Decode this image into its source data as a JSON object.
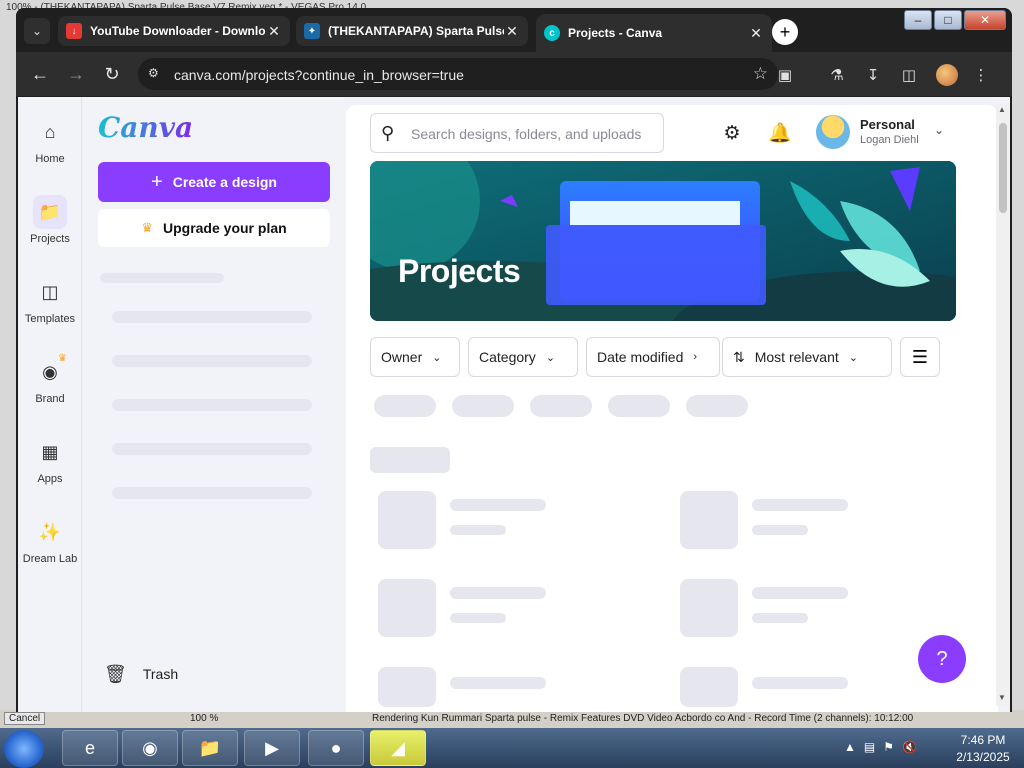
{
  "background_app": {
    "title": "100% - (THEKANTAPAPA) Sparta Pulse Base V7 Remix.veg * - VEGAS Pro 14.0",
    "cancel_label": "Cancel",
    "percent": "100 %",
    "render_status": "Rendering Kun Rummari Sparta pulse - Remix Features DVD Video Acbordo co And - Record Time (2 channels): 10:12:00"
  },
  "browser": {
    "tabs": [
      {
        "title": "YouTube Downloader - Downlo",
        "favicon": "download-icon",
        "color": "#e53935"
      },
      {
        "title": "(THEKANTAPAPA) Sparta Pulse",
        "favicon": "bird-icon",
        "color": "#2aa8d8"
      },
      {
        "title": "Projects - Canva",
        "favicon": "canva-icon",
        "color": "#00c4cc"
      }
    ],
    "url": "canva.com/projects?continue_in_browser=true"
  },
  "rail": [
    {
      "label": "Home",
      "icon": "home-icon"
    },
    {
      "label": "Projects",
      "icon": "folder-icon",
      "active": true
    },
    {
      "label": "Templates",
      "icon": "templates-icon"
    },
    {
      "label": "Brand",
      "icon": "brand-icon",
      "badge": "crown"
    },
    {
      "label": "Apps",
      "icon": "apps-icon"
    },
    {
      "label": "Dream Lab",
      "icon": "dream-lab-icon"
    }
  ],
  "sidepanel": {
    "logo": "Canva",
    "create_label": "Create a design",
    "upgrade_label": "Upgrade your plan",
    "trash_label": "Trash"
  },
  "header": {
    "search_placeholder": "Search designs, folders, and uploads",
    "account_type": "Personal",
    "account_name": "Logan Diehl"
  },
  "banner": {
    "title": "Projects"
  },
  "filters": [
    {
      "label": "Owner"
    },
    {
      "label": "Category"
    },
    {
      "label": "Date modified"
    }
  ],
  "sort": {
    "label": "Most relevant"
  },
  "help": {
    "label": "?"
  },
  "taskbar": {
    "time": "7:46 PM",
    "date": "2/13/2025"
  }
}
